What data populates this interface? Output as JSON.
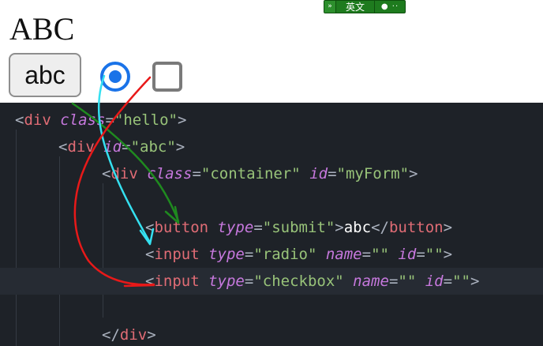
{
  "preview": {
    "heading": "ABC",
    "button_label": "abc",
    "radio_checked": true,
    "checkbox_checked": false
  },
  "ime_toolbar": {
    "language": "英文",
    "chevron": "»",
    "punct": "● ··"
  },
  "code": {
    "lines": [
      {
        "indent": 0,
        "tokens": [
          {
            "t": "<",
            "c": "punc"
          },
          {
            "t": "div",
            "c": "tag"
          },
          {
            "t": " ",
            "c": "punc"
          },
          {
            "t": "class",
            "c": "attr"
          },
          {
            "t": "=",
            "c": "punc"
          },
          {
            "t": "\"hello\"",
            "c": "str"
          },
          {
            "t": ">",
            "c": "punc"
          }
        ]
      },
      {
        "indent": 1,
        "tokens": [
          {
            "t": "<",
            "c": "punc"
          },
          {
            "t": "div",
            "c": "tag"
          },
          {
            "t": " ",
            "c": "punc"
          },
          {
            "t": "id",
            "c": "attr"
          },
          {
            "t": "=",
            "c": "punc"
          },
          {
            "t": "\"abc\"",
            "c": "str"
          },
          {
            "t": ">",
            "c": "punc"
          }
        ]
      },
      {
        "indent": 2,
        "tokens": [
          {
            "t": "<",
            "c": "punc"
          },
          {
            "t": "div",
            "c": "tag"
          },
          {
            "t": " ",
            "c": "punc"
          },
          {
            "t": "class",
            "c": "attr"
          },
          {
            "t": "=",
            "c": "punc"
          },
          {
            "t": "\"container\"",
            "c": "str"
          },
          {
            "t": " ",
            "c": "punc"
          },
          {
            "t": "id",
            "c": "attr"
          },
          {
            "t": "=",
            "c": "punc"
          },
          {
            "t": "\"myForm\"",
            "c": "str"
          },
          {
            "t": ">",
            "c": "punc"
          }
        ]
      },
      {
        "indent": 0,
        "tokens": []
      },
      {
        "indent": 3,
        "tokens": [
          {
            "t": "<",
            "c": "punc"
          },
          {
            "t": "button",
            "c": "tag"
          },
          {
            "t": " ",
            "c": "punc"
          },
          {
            "t": "type",
            "c": "attr"
          },
          {
            "t": "=",
            "c": "punc"
          },
          {
            "t": "\"submit\"",
            "c": "str"
          },
          {
            "t": ">",
            "c": "punc"
          },
          {
            "t": "abc",
            "c": "txt"
          },
          {
            "t": "</",
            "c": "punc"
          },
          {
            "t": "button",
            "c": "tag"
          },
          {
            "t": ">",
            "c": "punc"
          }
        ]
      },
      {
        "indent": 3,
        "tokens": [
          {
            "t": "<",
            "c": "punc"
          },
          {
            "t": "input",
            "c": "tag"
          },
          {
            "t": " ",
            "c": "punc"
          },
          {
            "t": "type",
            "c": "attr"
          },
          {
            "t": "=",
            "c": "punc"
          },
          {
            "t": "\"radio\"",
            "c": "str"
          },
          {
            "t": " ",
            "c": "punc"
          },
          {
            "t": "name",
            "c": "attr"
          },
          {
            "t": "=",
            "c": "punc"
          },
          {
            "t": "\"\"",
            "c": "str"
          },
          {
            "t": " ",
            "c": "punc"
          },
          {
            "t": "id",
            "c": "attr"
          },
          {
            "t": "=",
            "c": "punc"
          },
          {
            "t": "\"\"",
            "c": "str"
          },
          {
            "t": ">",
            "c": "punc"
          }
        ]
      },
      {
        "indent": 3,
        "current": true,
        "tokens": [
          {
            "t": "<",
            "c": "punc"
          },
          {
            "t": "input",
            "c": "tag"
          },
          {
            "t": " ",
            "c": "punc"
          },
          {
            "t": "type",
            "c": "attr"
          },
          {
            "t": "=",
            "c": "punc"
          },
          {
            "t": "\"checkbox\"",
            "c": "str"
          },
          {
            "t": " ",
            "c": "punc"
          },
          {
            "t": "name",
            "c": "attr"
          },
          {
            "t": "=",
            "c": "punc"
          },
          {
            "t": "\"\"",
            "c": "str"
          },
          {
            "t": " ",
            "c": "punc"
          },
          {
            "t": "id",
            "c": "attr"
          },
          {
            "t": "=",
            "c": "punc"
          },
          {
            "t": "\"\"",
            "c": "str"
          },
          {
            "t": ">",
            "c": "punc"
          }
        ]
      },
      {
        "indent": 0,
        "tokens": []
      },
      {
        "indent": 2,
        "tokens": [
          {
            "t": "</",
            "c": "punc"
          },
          {
            "t": "div",
            "c": "tag"
          },
          {
            "t": ">",
            "c": "punc"
          }
        ]
      }
    ]
  },
  "annotation_colors": {
    "green": "#1f8a1f",
    "cyan": "#35e0f0",
    "red": "#e81919"
  }
}
